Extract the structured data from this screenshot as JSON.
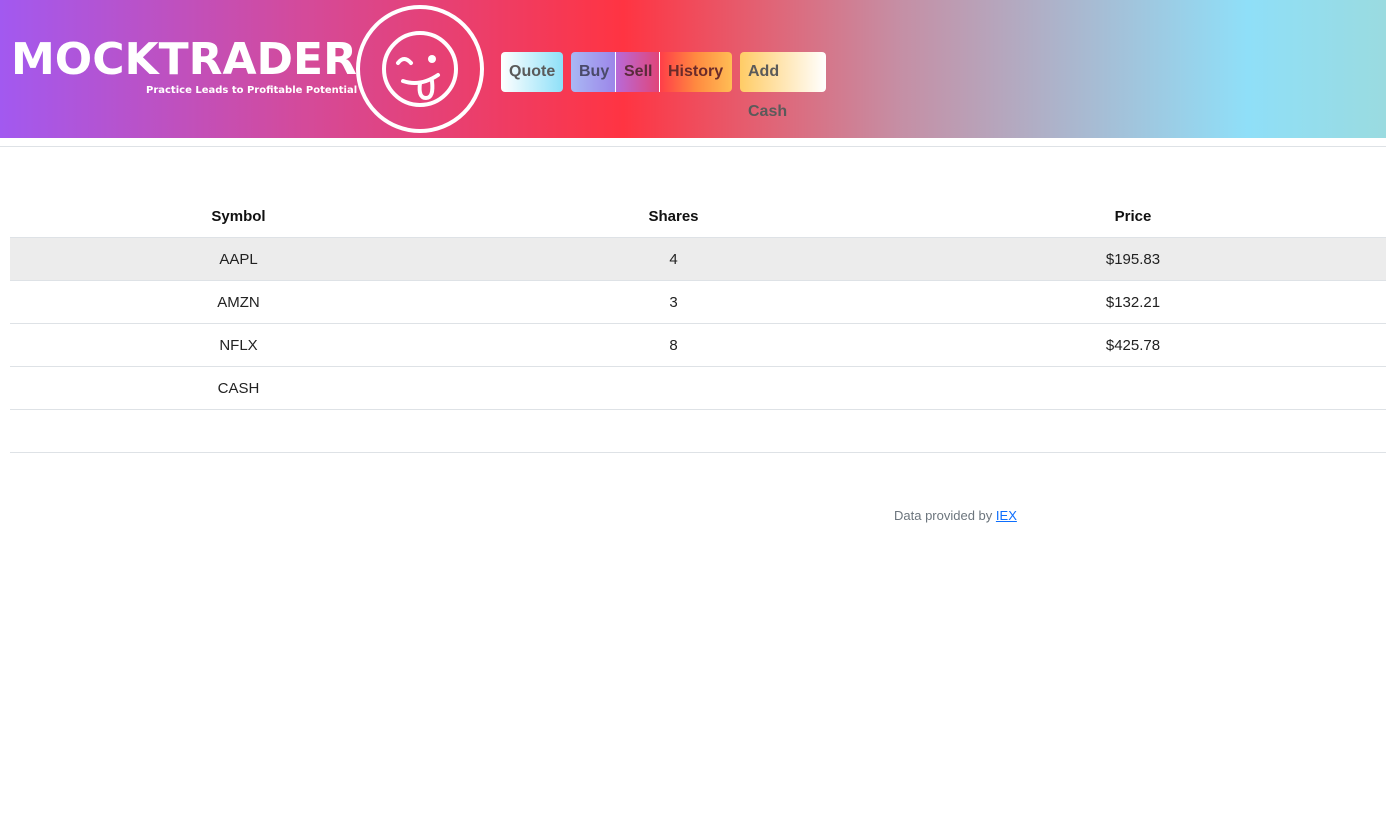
{
  "header": {
    "logo_title": "MOCKTRADER",
    "logo_tagline": "Practice Leads to Profitable Potential",
    "logo_icon": "winking-tongue-face-icon"
  },
  "nav": {
    "quote": "Quote",
    "buy": "Buy",
    "sell": "Sell",
    "history": "History",
    "add_cash": "Add Cash"
  },
  "table": {
    "headers": [
      "Symbol",
      "Shares",
      "Price"
    ],
    "rows": [
      {
        "symbol": "AAPL",
        "shares": "4",
        "price": "$195.83"
      },
      {
        "symbol": "AMZN",
        "shares": "3",
        "price": "$132.21"
      },
      {
        "symbol": "NFLX",
        "shares": "8",
        "price": "$425.78"
      },
      {
        "symbol": "CASH",
        "shares": "",
        "price": ""
      }
    ]
  },
  "footer": {
    "text": "Data provided by",
    "link": "IEX"
  }
}
